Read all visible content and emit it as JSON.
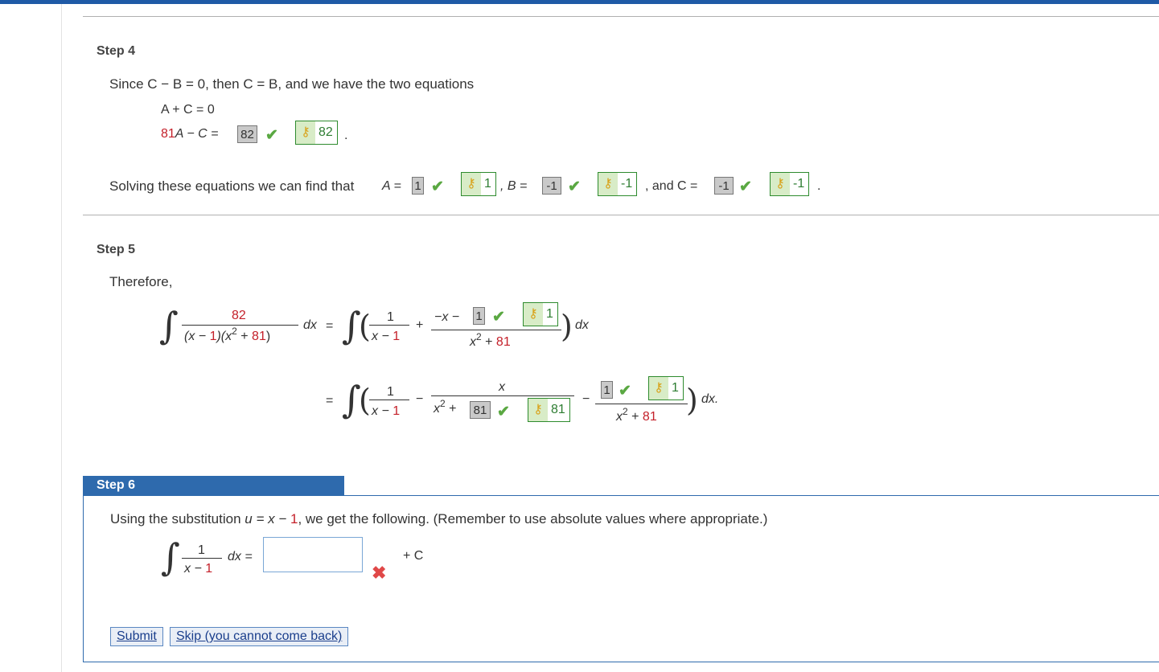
{
  "step4": {
    "label": "Step 4",
    "intro": "Since C − B = 0, then C = B, and we have the two equations",
    "eq1": "A + C = 0",
    "eq2_coef": "81",
    "eq2_rest": "A − C =",
    "eq2_input": "82",
    "eq2_key": "82",
    "solve_text": "Solving these equations we can find that",
    "A_label": "A =",
    "A_input": "1",
    "A_key": "1",
    "B_label": ", B =",
    "B_input": "-1",
    "B_key": "-1",
    "C_label": ", and C =",
    "C_input": "-1",
    "C_key": "-1"
  },
  "step5": {
    "label": "Step 5",
    "intro": "Therefore,",
    "lhs_num": "82",
    "lhs_den_a": "(x − ",
    "lhs_den_b": "1",
    "lhs_den_c": ")(x",
    "lhs_den_d": " + ",
    "lhs_den_e": "81",
    "lhs_den_f": ")",
    "dx": "dx",
    "eq": "=",
    "t1_num": "1",
    "t1_den_a": "x − ",
    "t1_den_b": "1",
    "plus": "+",
    "minus": "−",
    "t2_num_a": "−x −",
    "t2_input": "1",
    "t2_key": "1",
    "t2_den_a": "x",
    "t2_den_b": " + ",
    "t2_den_c": "81",
    "l2_t2_num": "x",
    "l2_t2_den_a": "x",
    "l2_t2_den_b": " +",
    "l2_t2_input": "81",
    "l2_t2_key": "81",
    "l2_t3_input": "1",
    "l2_t3_key": "1",
    "l2_t3_den_a": "x",
    "l2_t3_den_b": " + ",
    "l2_t3_den_c": "81",
    "dx_end": "dx."
  },
  "step6": {
    "label": "Step 6",
    "intro_a": "Using the substitution ",
    "intro_b": "u = x − ",
    "intro_c": "1",
    "intro_d": ", we get the following. (Remember to use absolute values where appropriate.)",
    "frac_num": "1",
    "frac_den_a": "x − ",
    "frac_den_b": "1",
    "dx_eq": "dx =",
    "answer_value": "",
    "plus_c": "+ C",
    "submit_label": "Submit",
    "skip_label": "Skip (you cannot come back)"
  },
  "icons": {
    "check": "checkmark-icon",
    "key": "key-icon",
    "cross": "cross-icon"
  }
}
